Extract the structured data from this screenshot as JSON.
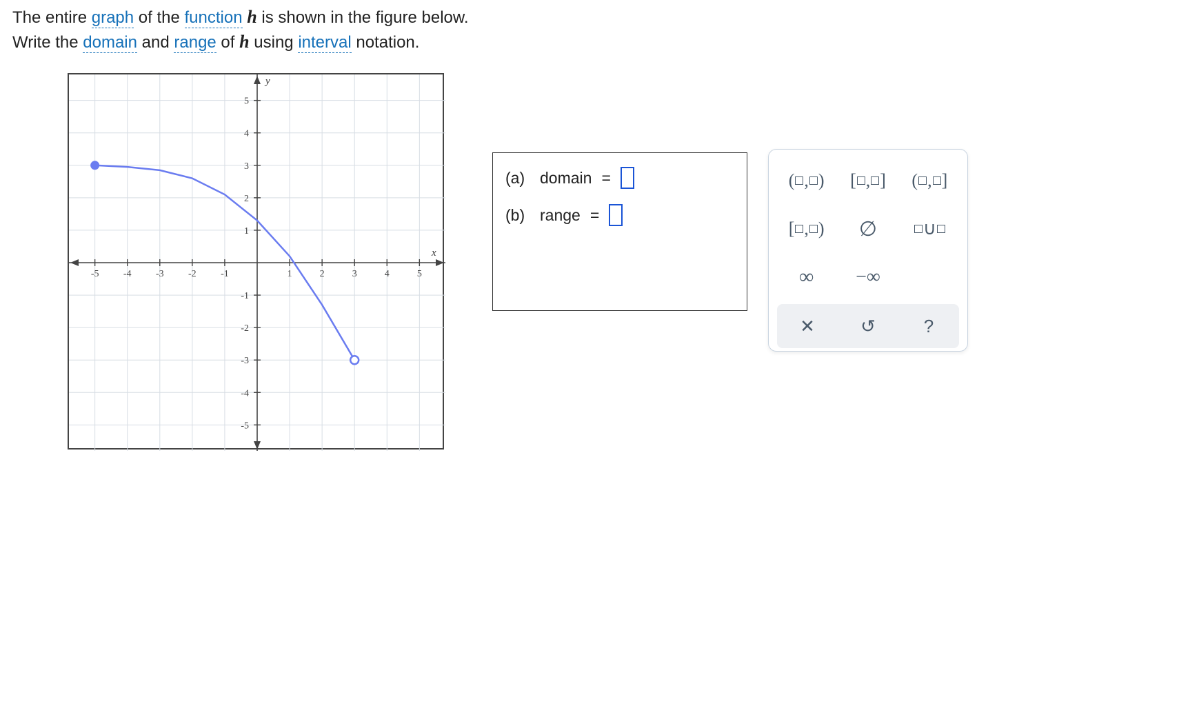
{
  "prompt": {
    "line1_pre": "The entire ",
    "graph_term": "graph",
    "line1_mid": " of the ",
    "function_term": "function",
    "line1_after_func": " ",
    "function_name": "h",
    "line1_end": " is shown in the figure below.",
    "line2_pre": "Write the ",
    "domain_term": "domain",
    "line2_and": " and ",
    "range_term": "range",
    "line2_mid": " of ",
    "line2_after_name": " using ",
    "interval_term": "interval",
    "line2_end": " notation."
  },
  "answers": {
    "a_part": "(a)",
    "a_label": "domain",
    "eq": "=",
    "b_part": "(b)",
    "b_label": "range"
  },
  "palette": {
    "open_open": "(□,□)",
    "closed_closed": "[□,□]",
    "open_closed": "(□,□]",
    "closed_open": "[□,□)",
    "empty_set": "∅",
    "union_label": "□∪□",
    "infinity": "∞",
    "neg_infinity": "−∞",
    "clear": "✕",
    "reset": "↺",
    "help": "?"
  },
  "chart_data": {
    "type": "line",
    "xlabel": "x",
    "ylabel": "y",
    "xlim": [
      -5.8,
      5.8
    ],
    "ylim": [
      -5.8,
      5.8
    ],
    "x_ticks": [
      -5,
      -4,
      -3,
      -2,
      -1,
      1,
      2,
      3,
      4,
      5
    ],
    "y_ticks": [
      -5,
      -4,
      -3,
      -2,
      -1,
      1,
      2,
      3,
      4,
      5
    ],
    "series": [
      {
        "name": "h",
        "points": [
          {
            "x": -5,
            "y": 3,
            "endpoint": "closed"
          },
          {
            "x": -4,
            "y": 2.95
          },
          {
            "x": -3,
            "y": 2.85
          },
          {
            "x": -2,
            "y": 2.6
          },
          {
            "x": -1,
            "y": 2.1
          },
          {
            "x": 0,
            "y": 1.3
          },
          {
            "x": 1,
            "y": 0.2
          },
          {
            "x": 2,
            "y": -1.3
          },
          {
            "x": 3,
            "y": -3,
            "endpoint": "open"
          }
        ],
        "color": "#6a7cf0"
      }
    ]
  }
}
